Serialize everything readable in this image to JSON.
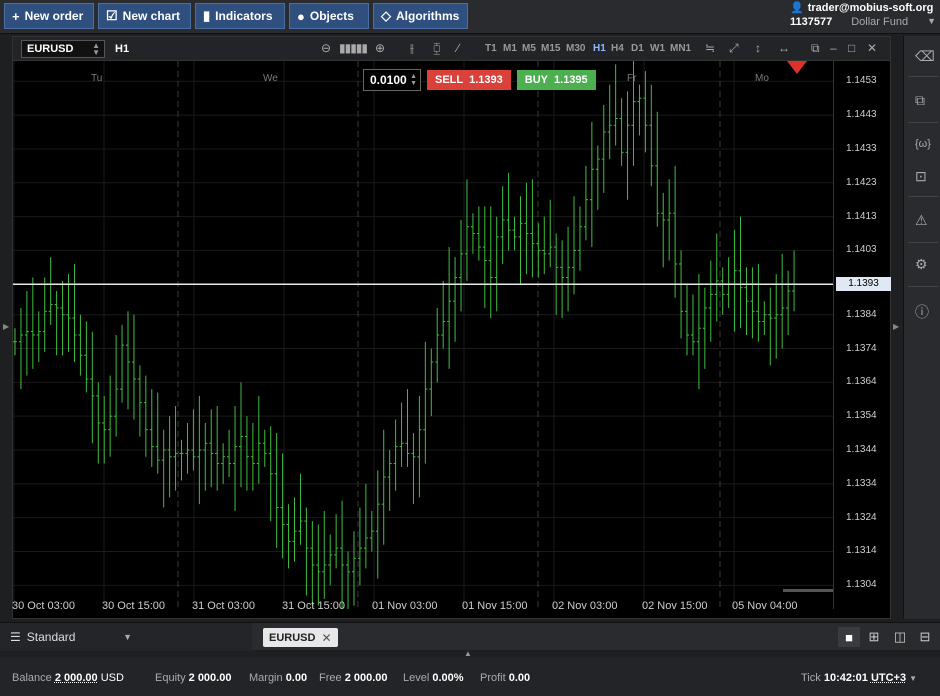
{
  "toolbar": {
    "buttons": [
      {
        "label": "New order",
        "icon": "plus-icon"
      },
      {
        "label": "New chart",
        "icon": "chart-icon"
      },
      {
        "label": "Indicators",
        "icon": "bars-icon"
      },
      {
        "label": "Objects",
        "icon": "objects-icon"
      },
      {
        "label": "Algorithms",
        "icon": "diamond-icon"
      }
    ]
  },
  "account": {
    "user": "trader@mobius-soft.org",
    "number": "1137577",
    "fund": "Dollar Fund"
  },
  "chart": {
    "symbol": "EURUSD",
    "timeframe": "H1",
    "timeframes": [
      "T1",
      "M1",
      "M5",
      "M15",
      "M30",
      "H1",
      "H4",
      "D1",
      "W1",
      "MN1"
    ],
    "active_timeframe": "H1",
    "lot": "0.0100",
    "sell_label": "SELL",
    "sell_price": "1.1393",
    "buy_label": "BUY",
    "buy_price": "1.1395",
    "current_price_label": "1.1393",
    "day_labels": [
      "Tu",
      "We",
      "Fr",
      "Mo"
    ],
    "colors": {
      "bull": "#3fbf3f",
      "sell": "#d9413a",
      "buy": "#4caf50",
      "marker": "#e0302a"
    }
  },
  "chart_data": {
    "type": "bar",
    "title": "",
    "series": [
      {
        "values": [
          1.1376,
          1.1378,
          1.1379,
          1.1378,
          1.1379,
          1.1385,
          1.1387,
          1.1386,
          1.1384,
          1.1383,
          1.1378,
          1.1372,
          1.1365,
          1.136,
          1.1352,
          1.135,
          1.1354,
          1.1362,
          1.1375,
          1.137,
          1.1365,
          1.1358,
          1.135,
          1.1345,
          1.1341,
          1.1344,
          1.1342,
          1.1343,
          1.1343,
          1.1344,
          1.1342,
          1.1344,
          1.1346,
          1.1343,
          1.134,
          1.1342,
          1.134,
          1.1345,
          1.1348,
          1.1342,
          1.134,
          1.1346,
          1.1343,
          1.1337,
          1.1327,
          1.1322,
          1.1317,
          1.132,
          1.1323,
          1.1315,
          1.131,
          1.1308,
          1.131,
          1.1313,
          1.1315,
          1.131,
          1.1308,
          1.1312,
          1.1315,
          1.1318,
          1.132,
          1.1328,
          1.1336,
          1.134,
          1.1345,
          1.1346,
          1.1343,
          1.1342,
          1.135,
          1.1362,
          1.137,
          1.1378,
          1.1382,
          1.1388,
          1.1395,
          1.1402,
          1.141,
          1.1408,
          1.1404,
          1.14,
          1.1395,
          1.1407,
          1.1412,
          1.1409,
          1.1407,
          1.1411,
          1.1408,
          1.1405,
          1.1403,
          1.1402,
          1.1404,
          1.1398,
          1.1395,
          1.1398,
          1.1403,
          1.141,
          1.1418,
          1.1427,
          1.143,
          1.1438,
          1.144,
          1.1442,
          1.1432,
          1.144,
          1.1447,
          1.1448,
          1.144,
          1.1428,
          1.1414,
          1.1412,
          1.1414,
          1.1399,
          1.1385,
          1.1378,
          1.1376,
          1.138,
          1.1386,
          1.139,
          1.1394,
          1.139,
          1.1393,
          1.1397,
          1.1392,
          1.1388,
          1.1385,
          1.1382,
          1.1384,
          1.1383,
          1.1384,
          1.1386,
          1.1391,
          1.1393
        ]
      }
    ],
    "ylim": [
      1.1297,
      1.1459
    ],
    "y_ticks": [
      "1.1453",
      "1.1443",
      "1.1433",
      "1.1423",
      "1.1413",
      "1.1403",
      "1.1393",
      "1.1384",
      "1.1374",
      "1.1364",
      "1.1354",
      "1.1344",
      "1.1334",
      "1.1324",
      "1.1314",
      "1.1304"
    ],
    "x_ticks": [
      "30 Oct 03:00",
      "30 Oct 15:00",
      "31 Oct 03:00",
      "31 Oct 15:00",
      "01 Nov 03:00",
      "01 Nov 15:00",
      "02 Nov 03:00",
      "02 Nov 15:00",
      "05 Nov 04:00"
    ],
    "current_price": 1.1393,
    "grid": true
  },
  "sidebar": {
    "icons": [
      "eraser-icon",
      "copy-icon",
      "bracket-icon",
      "terminal-icon",
      "warning-icon",
      "gear-icon",
      "info-icon"
    ]
  },
  "tabs": {
    "template": "Standard",
    "open": [
      {
        "label": "EURUSD"
      }
    ]
  },
  "status": {
    "balance_label": "Balance",
    "balance": "2 000.00",
    "currency": "USD",
    "equity_label": "Equity",
    "equity": "2 000.00",
    "margin_label": "Margin",
    "margin": "0.00",
    "free_label": "Free",
    "free": "2 000.00",
    "level_label": "Level",
    "level": "0.00%",
    "profit_label": "Profit",
    "profit": "0.00",
    "tick_label": "Tick",
    "time": "10:42:01",
    "timezone": "UTC+3"
  }
}
